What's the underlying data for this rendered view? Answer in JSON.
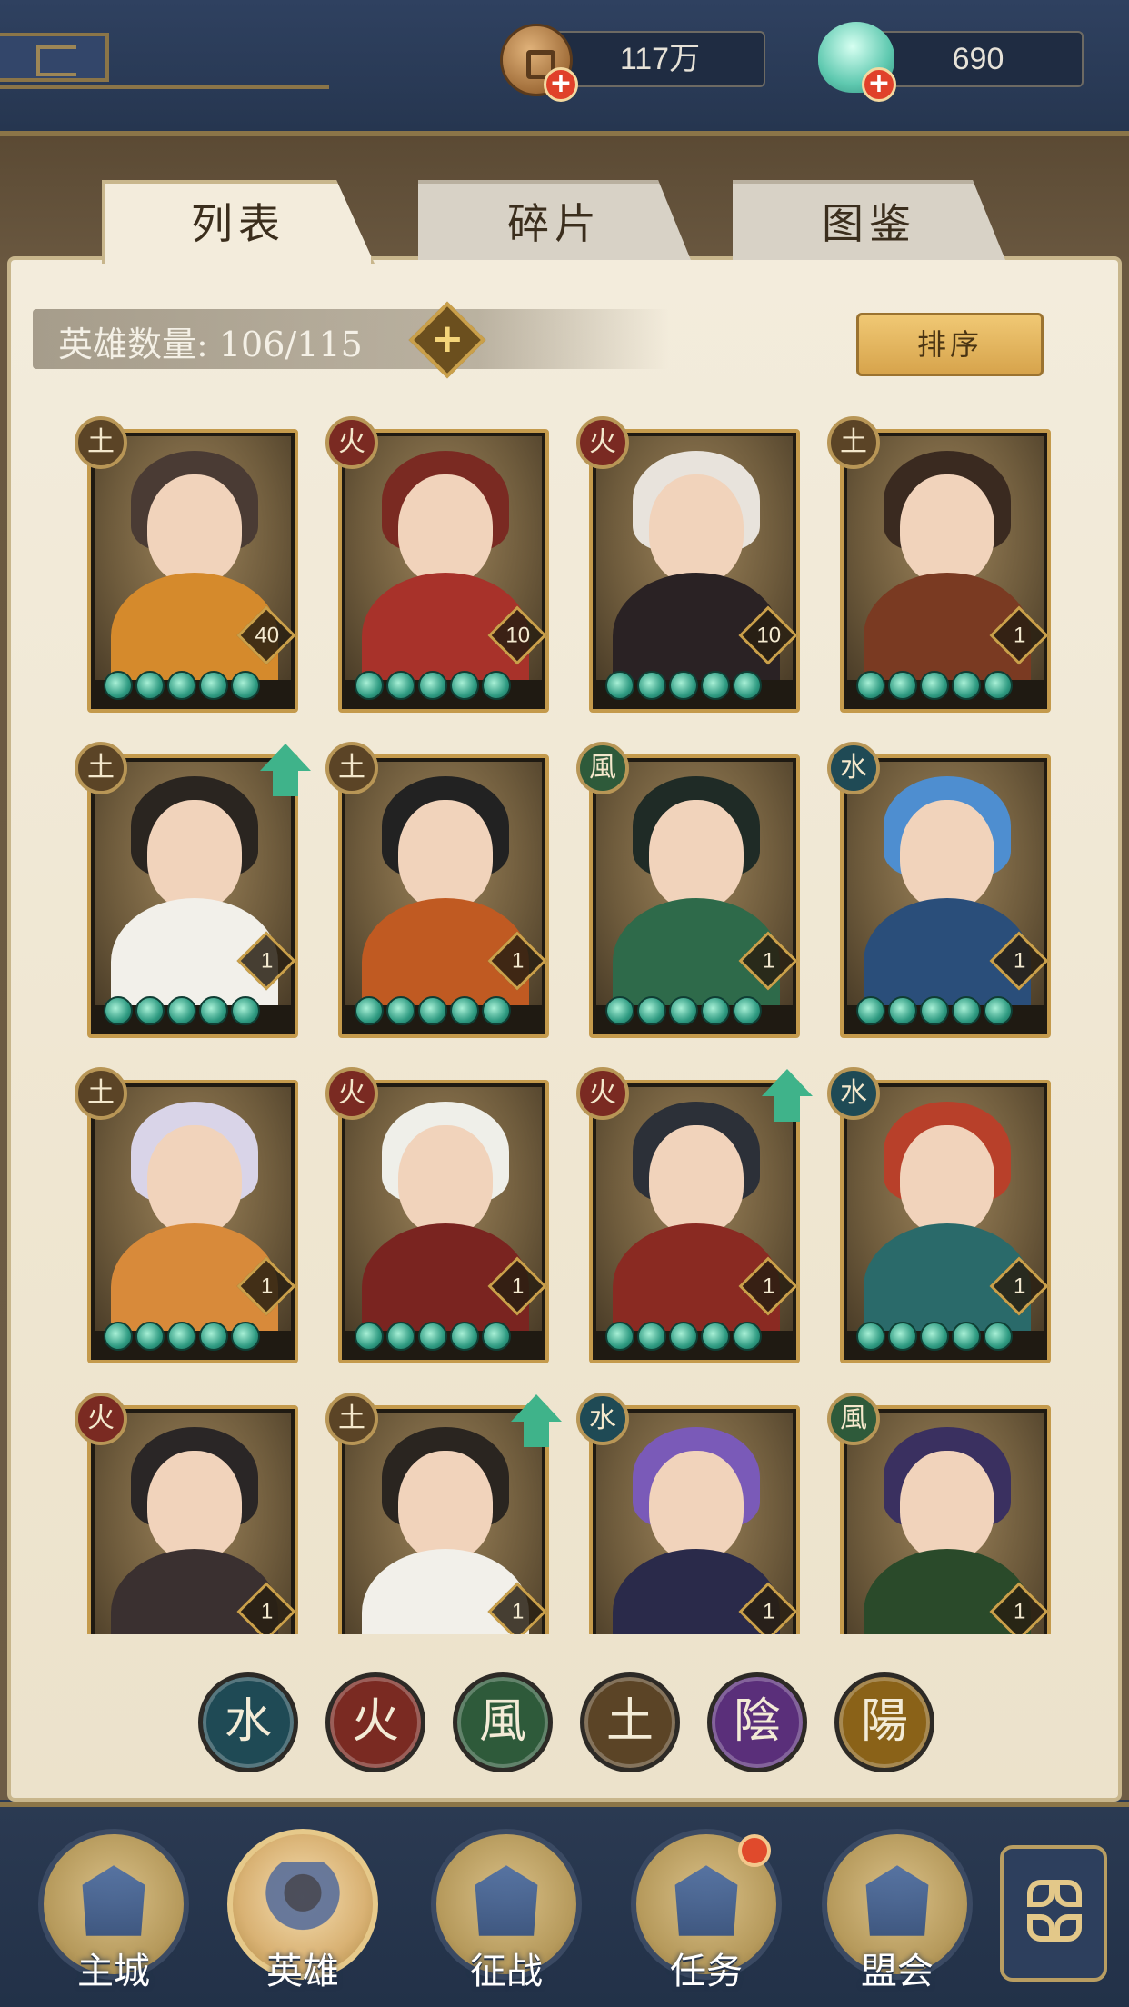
{
  "header": {
    "coins": "117万",
    "jade": "690",
    "coin_icon": "coin-icon",
    "jade_icon": "jade-icon"
  },
  "tabs": [
    {
      "label": "列表",
      "active": true
    },
    {
      "label": "碎片",
      "active": false
    },
    {
      "label": "图鉴",
      "active": false
    }
  ],
  "hero_count": {
    "text": "英雄数量: 106/115",
    "add_icon": "plus-icon"
  },
  "sort_button": "排序",
  "colors": {
    "earth": "#5b4426",
    "fire": "#7a2a22",
    "wood": "#2e5a3a",
    "water": "#1f4a55",
    "yin": "#5a2f7a",
    "yang": "#8a6218",
    "accent_gold": "#c49a4c",
    "star_jade": "#2f9b82"
  },
  "heroes": [
    {
      "element": "土",
      "level": "40",
      "stars": 5,
      "upgrade": false
    },
    {
      "element": "火",
      "level": "10",
      "stars": 5,
      "upgrade": false
    },
    {
      "element": "火",
      "level": "10",
      "stars": 5,
      "upgrade": false
    },
    {
      "element": "土",
      "level": "1",
      "stars": 5,
      "upgrade": false
    },
    {
      "element": "土",
      "level": "1",
      "stars": 5,
      "upgrade": true
    },
    {
      "element": "土",
      "level": "1",
      "stars": 5,
      "upgrade": false
    },
    {
      "element": "風",
      "level": "1",
      "stars": 5,
      "upgrade": false
    },
    {
      "element": "水",
      "level": "1",
      "stars": 5,
      "upgrade": false
    },
    {
      "element": "土",
      "level": "1",
      "stars": 5,
      "upgrade": false
    },
    {
      "element": "火",
      "level": "1",
      "stars": 5,
      "upgrade": false
    },
    {
      "element": "火",
      "level": "1",
      "stars": 5,
      "upgrade": true
    },
    {
      "element": "水",
      "level": "1",
      "stars": 5,
      "upgrade": false
    },
    {
      "element": "火",
      "level": "1",
      "stars": 0,
      "upgrade": false
    },
    {
      "element": "土",
      "level": "1",
      "stars": 0,
      "upgrade": true
    },
    {
      "element": "水",
      "level": "1",
      "stars": 0,
      "upgrade": false
    },
    {
      "element": "風",
      "level": "1",
      "stars": 0,
      "upgrade": false
    }
  ],
  "element_filters": [
    {
      "glyph": "水",
      "key": "water"
    },
    {
      "glyph": "火",
      "key": "fire"
    },
    {
      "glyph": "風",
      "key": "wood"
    },
    {
      "glyph": "土",
      "key": "earth"
    },
    {
      "glyph": "陰",
      "key": "yin"
    },
    {
      "glyph": "陽",
      "key": "yang"
    }
  ],
  "nav": [
    {
      "label": "主城",
      "icon": "castle-icon",
      "active": false
    },
    {
      "label": "英雄",
      "icon": "hero-icon",
      "active": true
    },
    {
      "label": "征战",
      "icon": "battle-icon",
      "active": false
    },
    {
      "label": "任务",
      "icon": "task-icon",
      "active": false,
      "badge": true
    },
    {
      "label": "盟会",
      "icon": "alliance-icon",
      "active": false
    }
  ],
  "menu_icon": "menu-flower-icon"
}
